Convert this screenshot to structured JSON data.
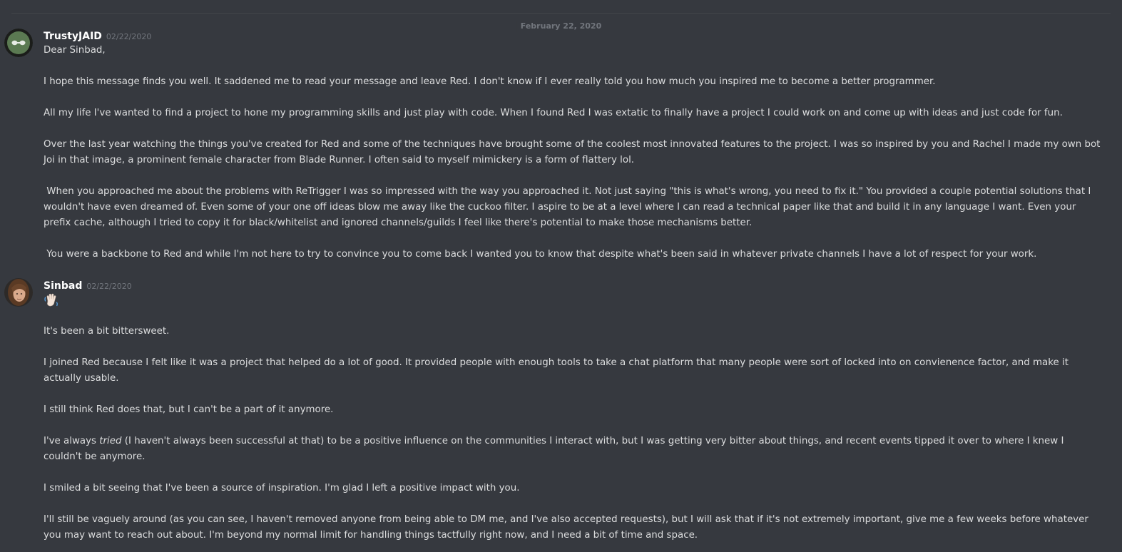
{
  "date_divider": "February 22, 2020",
  "messages": [
    {
      "username": "TrustyJAID",
      "timestamp": "02/22/2020",
      "avatar_icon": "trustyjaid-avatar",
      "paragraphs": [
        "Dear Sinbad,",
        "I hope this message finds you well. It saddened me to read your message and leave Red. I don't know if I ever really told you how much you inspired me to become a better programmer.",
        "All my life I've wanted to find a project to hone my programming skills and just play with code. When I found Red I was extatic to finally have a project I could work on and come up with ideas and just code for fun.",
        "Over the last year watching the things you've created for Red and some of the techniques have brought some of the coolest most innovated features to the project. I was so inspired by you and Rachel I made my own bot Joi in that image, a prominent female character from Blade Runner. I often said to myself mimickery is a form of flattery lol.",
        " When you approached me about the problems with ReTrigger I was so impressed with the way you approached it. Not just saying \"this is what's wrong, you need to fix it.\" You provided a couple potential solutions that I wouldn't have even dreamed of. Even some of your one off ideas blow me away like the cuckoo filter. I aspire to be at a level where I can read a technical paper like that and build it in any language I want. Even your prefix cache, although I tried to copy it for black/whitelist and ignored channels/guilds I feel like there's potential to make those mechanisms better.",
        " You were a backbone to Red and while I'm not here to try to convince you to come back I wanted you to know that despite what's been said in whatever private channels I have a lot of respect for your work."
      ]
    },
    {
      "username": "Sinbad",
      "timestamp": "02/22/2020",
      "avatar_icon": "sinbad-avatar",
      "emoji_icon": "waving-hand-emoji",
      "paragraphs": [
        "It's been a bit bittersweet.",
        "I joined Red because I felt like it was a project that helped do a lot of good. It provided people with enough tools to take a chat platform that many people were sort of locked into on convienence factor, and make it actually usable.",
        "I still think Red does that, but I can't be a part of it anymore.",
        "I've always ",
        "I smiled a bit seeing that I've been a source of inspiration. I'm glad I left a positive impact with you.",
        "I'll still be vaguely around (as you can see, I haven't removed anyone from being able to DM me, and I've also accepted requests), but I will ask that if it's not extremely important, give me a few weeks before whatever you may want to reach out about. I'm beyond my normal limit for handling things tactfully right now, and I need a bit of time and space."
      ],
      "emphasis": "tried",
      "after_emphasis": " (I haven't always been successful at that) to be a positive influence on the communities I interact with, but I was getting very bitter about things, and recent events tipped it over to where I knew I couldn't be anymore."
    }
  ],
  "colors": {
    "background": "#36393f",
    "text": "#dcddde",
    "username": "#ffffff",
    "muted": "#72767d"
  }
}
